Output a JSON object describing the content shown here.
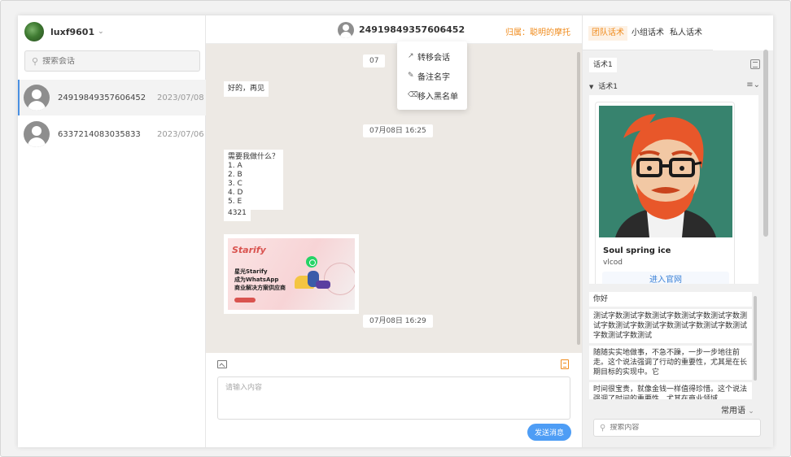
{
  "user": {
    "name": "luxf9601"
  },
  "left": {
    "search_placeholder": "搜索会话",
    "contacts": [
      {
        "name": "24919849357606452",
        "date": "2023/07/08"
      },
      {
        "name": "6337214083035833",
        "date": "2023/07/06"
      }
    ]
  },
  "chat": {
    "contact_name": "24919849357606452",
    "belong_label": "归属：聪明的摩托",
    "menu": {
      "transfer": "转移会话",
      "remark": "备注名字",
      "blacklist": "移入黑名单"
    },
    "messages": {
      "time_1_partial": "07",
      "goodbye": "好的，再见",
      "time_2": "07月08日 16:25",
      "options_title": "需要我做什么？",
      "options": [
        "1. A",
        "2. B",
        "3. C",
        "4. D",
        "5. E"
      ],
      "number": "4321",
      "promo": {
        "logo": "Starify",
        "line1": "星光Starify",
        "line2": "成为WhatsApp",
        "line3": "商业解决方案供应商"
      },
      "time_3": "07月08日 16:29"
    },
    "input_placeholder": "请输入内容",
    "send_label": "发送消息"
  },
  "right": {
    "tabs": [
      "团队话术",
      "小组话术",
      "私人话术"
    ],
    "active_tab": 0,
    "script_tag": "话术1",
    "group_label": "话术1",
    "card": {
      "title": "Soul spring ice",
      "subtitle": "vlcod",
      "link": "进入官网"
    },
    "phrases": [
      "你好",
      "测试字数测试字数测试字数测试字数测试字数测试字数测试字数测试字数测试字数测试字数测试字数测试字数测试",
      "随随实实地做事，不急不躁，一步一步地往前走。这个说法强调了行动的重要性，尤其是在长期目标的实现中。它",
      "时间很宝贵，就像金钱一样值得珍惜。这个说法强调了时间的重要性，尤其在商业领域"
    ],
    "common_label": "常用语",
    "search_placeholder": "搜索内容"
  },
  "colors": {
    "accent": "#f08c1e",
    "primary": "#4e9df5",
    "chat_bg": "#ede9e4"
  }
}
